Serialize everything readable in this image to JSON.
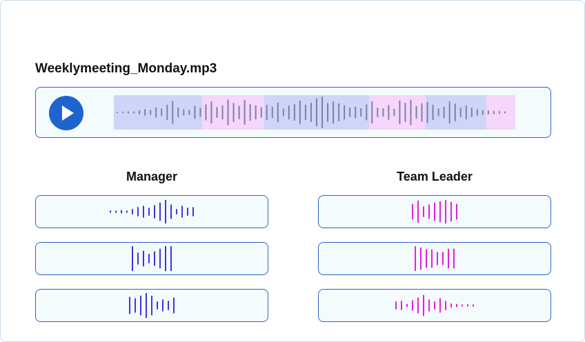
{
  "file": {
    "name": "Weeklymeeting_Monday.mp3"
  },
  "player": {
    "play_icon": "play-icon",
    "segment_colors": {
      "manager": "#cfd5f9",
      "team_leader": "#f6d6fb"
    },
    "segments": [
      "manager",
      "team_leader",
      "manager",
      "team_leader",
      "manager",
      "team_leader"
    ],
    "waveform_color": "#7d7fa6"
  },
  "speakers": [
    {
      "name": "Manager",
      "color": "#3a36d8",
      "clips": [
        {
          "levels": [
            0.08,
            0.08,
            0.12,
            0.08,
            0.2,
            0.35,
            0.45,
            0.3,
            0.5,
            0.7,
            0.9,
            0.55,
            0.2,
            0.45,
            0.3,
            0.35
          ]
        },
        {
          "levels": [
            0.95,
            0.45,
            0.6,
            0.35,
            0.55,
            0.75,
            0.95,
            0.95
          ]
        },
        {
          "levels": [
            0.65,
            0.55,
            0.75,
            0.95,
            0.75,
            0.3,
            0.45,
            0.35,
            0.6
          ]
        }
      ]
    },
    {
      "name": "Team Leader",
      "color": "#e51ee0",
      "clips": [
        {
          "levels": [
            0.6,
            0.85,
            0.4,
            0.55,
            0.7,
            0.8,
            0.9,
            0.75,
            0.6
          ]
        },
        {
          "levels": [
            0.95,
            0.85,
            0.7,
            0.7,
            0.5,
            0.5,
            0.75,
            0.75
          ]
        },
        {
          "levels": [
            0.3,
            0.35,
            0.12,
            0.4,
            0.6,
            0.8,
            0.45,
            0.3,
            0.55,
            0.35,
            0.15,
            0.12,
            0.08,
            0.08,
            0.08
          ]
        }
      ]
    }
  ]
}
